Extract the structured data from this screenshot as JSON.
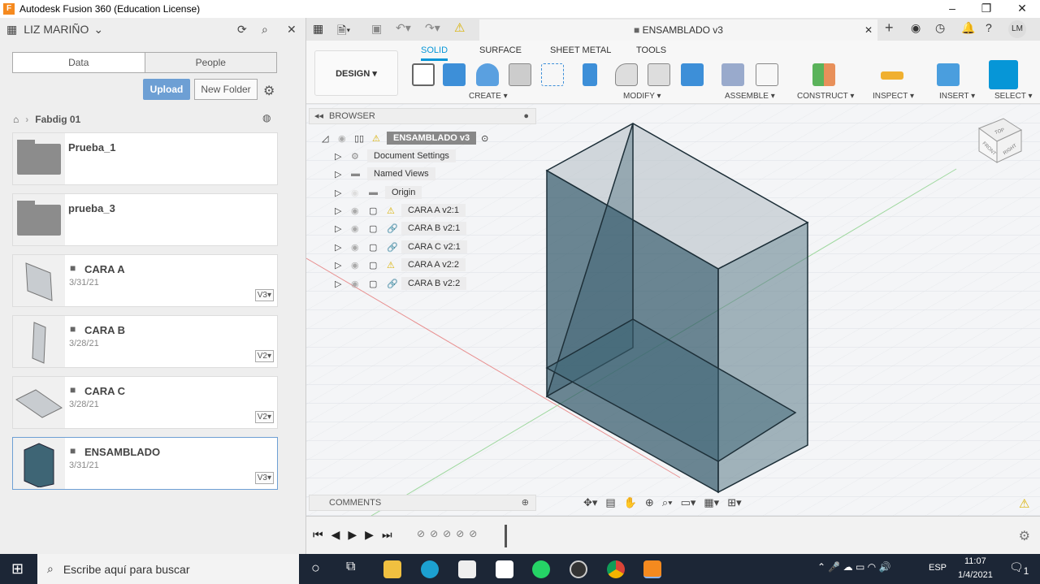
{
  "window": {
    "title": "Autodesk Fusion 360 (Education License)",
    "logo": "F"
  },
  "left": {
    "user": "LIZ MARIÑO",
    "tabs": [
      "Data",
      "People"
    ],
    "upload": "Upload",
    "new_folder": "New Folder",
    "breadcrumb": "Fabdig 01",
    "items": [
      {
        "name": "Prueba_1",
        "type": "folder"
      },
      {
        "name": "prueba_3",
        "type": "folder"
      },
      {
        "name": "CARA A",
        "date": "3/31/21",
        "version": "V3▾"
      },
      {
        "name": "CARA B",
        "date": "3/28/21",
        "version": "V2▾"
      },
      {
        "name": "CARA C",
        "date": "3/28/21",
        "version": "V2▾"
      },
      {
        "name": "ENSAMBLADO",
        "date": "3/31/21",
        "version": "V3▾"
      }
    ]
  },
  "doc": {
    "tab": "ENSAMBLADO v3",
    "user_initials": "LM"
  },
  "toolbar": {
    "workspace": "DESIGN ▾",
    "tabs": [
      "SOLID",
      "SURFACE",
      "SHEET METAL",
      "TOOLS"
    ],
    "groups": [
      "CREATE ▾",
      "MODIFY ▾",
      "ASSEMBLE ▾",
      "CONSTRUCT ▾",
      "INSPECT ▾",
      "INSERT ▾",
      "SELECT ▾"
    ]
  },
  "browser": {
    "title": "BROWSER",
    "root": "ENSAMBLADO v3",
    "nodes": [
      {
        "label": "Document Settings",
        "icon": "gear-icon"
      },
      {
        "label": "Named Views",
        "icon": "folder-icon"
      },
      {
        "label": "Origin",
        "icon": "folder-icon"
      },
      {
        "label": "CARA  A v2:1",
        "icon": "warning-icon"
      },
      {
        "label": "CARA B v2:1",
        "icon": "link-icon"
      },
      {
        "label": "CARA C v2:1",
        "icon": "link-icon"
      },
      {
        "label": "CARA  A v2:2",
        "icon": "warning-icon"
      },
      {
        "label": "CARA B v2:2",
        "icon": "link-icon"
      }
    ]
  },
  "comments": "COMMENTS",
  "viewcube": {
    "top": "TOP",
    "front": "FRONT",
    "right": "RIGHT"
  },
  "taskbar": {
    "search": "Escribe aquí para buscar",
    "lang": "ESP",
    "time": "11:07",
    "date": "1/4/2021",
    "notif": "1"
  },
  "colors": {
    "accent": "#0696d7",
    "upload": "#6d9fd4",
    "model": "#2f5566"
  }
}
